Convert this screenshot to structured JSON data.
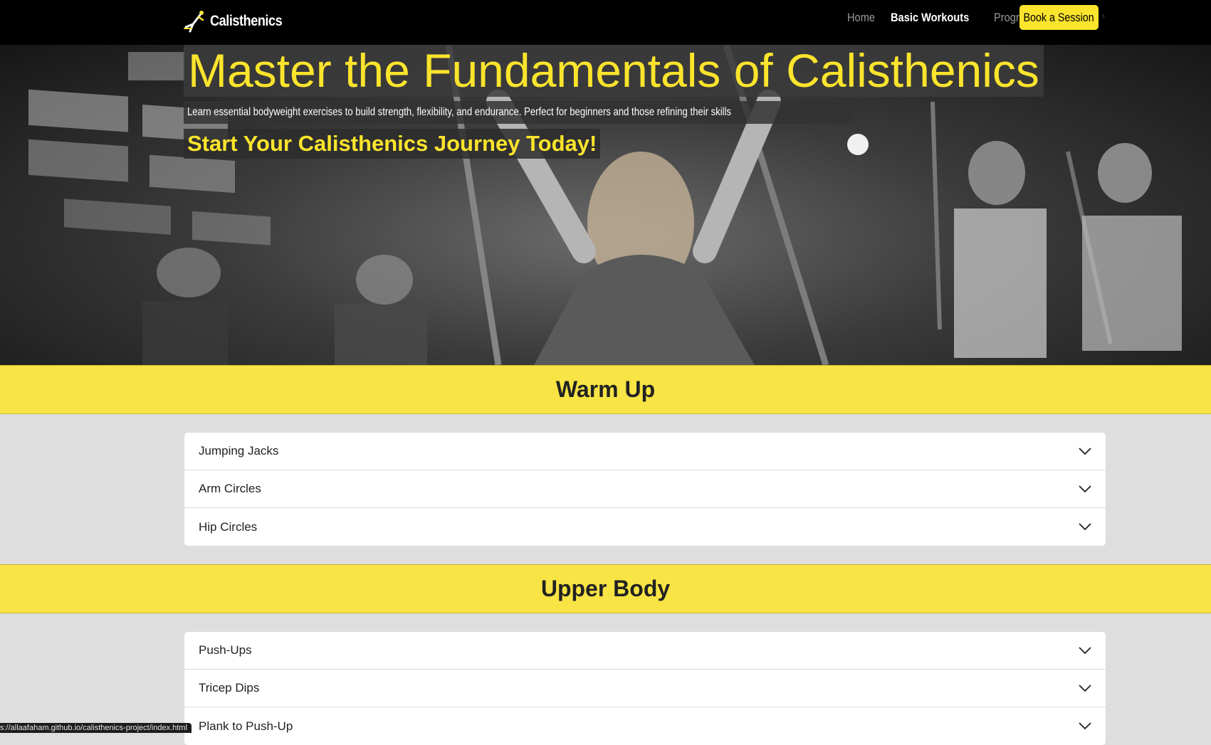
{
  "brand": {
    "name": "Calisthenics",
    "logo_icon": "gymnast-icon"
  },
  "nav": {
    "links": [
      {
        "label": "Home",
        "active": false
      },
      {
        "label": "Basic Workouts",
        "active": true
      },
      {
        "label": "Progress",
        "active": false
      }
    ],
    "cta_label": "Book a Session"
  },
  "hero": {
    "title": "Master the Fundamentals of Calisthenics",
    "subtitle": "Learn essential bodyweight exercises to build strength, flexibility, and endurance. Perfect for beginners and those refining their skills",
    "cta": "Start Your Calisthenics Journey Today!"
  },
  "sections": [
    {
      "title": "Warm Up",
      "items": [
        "Jumping Jacks",
        "Arm Circles",
        "Hip Circles"
      ]
    },
    {
      "title": "Upper Body",
      "items": [
        "Push-Ups",
        "Tricep Dips",
        "Plank to Push-Up"
      ]
    }
  ],
  "status_url": "s://allaafaham.github.io/calisthenics-project/index.html",
  "colors": {
    "accent": "#fbe42c",
    "section_bar": "#f8e444",
    "navbar": "#000000",
    "page_bg": "#dedede"
  }
}
